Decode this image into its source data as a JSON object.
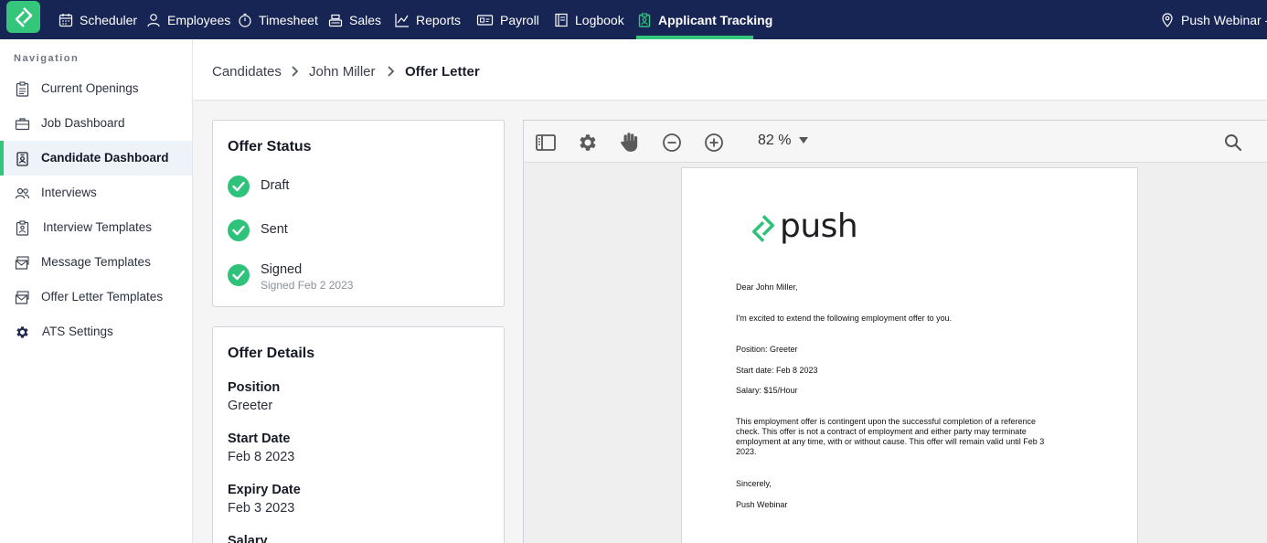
{
  "topnav": {
    "items": [
      {
        "label": "Scheduler",
        "icon": "calendar-icon"
      },
      {
        "label": "Employees",
        "icon": "person-icon"
      },
      {
        "label": "Timesheet",
        "icon": "stopwatch-icon"
      },
      {
        "label": "Sales",
        "icon": "register-icon"
      },
      {
        "label": "Reports",
        "icon": "chart-line-icon"
      },
      {
        "label": "Payroll",
        "icon": "money-icon"
      },
      {
        "label": "Logbook",
        "icon": "book-icon"
      },
      {
        "label": "Applicant Tracking",
        "icon": "clipboard-person-icon",
        "active": true
      }
    ],
    "location": "Push Webinar - A",
    "accent": "#34c77b",
    "background": "#172554"
  },
  "sidebar": {
    "heading": "Navigation",
    "items": [
      {
        "label": "Current Openings",
        "icon": "clipboard-list-icon"
      },
      {
        "label": "Job Dashboard",
        "icon": "briefcase-icon"
      },
      {
        "label": "Candidate Dashboard",
        "icon": "id-badge-icon",
        "active": true
      },
      {
        "label": "Interviews",
        "icon": "people-icon"
      },
      {
        "label": "Interview Templates",
        "icon": "clipboard-person-icon"
      },
      {
        "label": "Message Templates",
        "icon": "envelope-stack-icon"
      },
      {
        "label": "Offer Letter Templates",
        "icon": "envelope-stack-icon"
      },
      {
        "label": "ATS Settings",
        "icon": "gear-icon"
      }
    ]
  },
  "breadcrumb": [
    "Candidates",
    "John Miller",
    "Offer Letter"
  ],
  "offer_status": {
    "title": "Offer Status",
    "steps": [
      {
        "label": "Draft",
        "done": true
      },
      {
        "label": "Sent",
        "done": true
      },
      {
        "label": "Signed",
        "sub": "Signed Feb 2 2023",
        "done": true
      }
    ]
  },
  "offer_details": {
    "title": "Offer Details",
    "fields": [
      {
        "label": "Position",
        "value": "Greeter"
      },
      {
        "label": "Start Date",
        "value": "Feb 8 2023"
      },
      {
        "label": "Expiry Date",
        "value": "Feb 3 2023"
      },
      {
        "label": "Salary",
        "value": ""
      }
    ]
  },
  "viewer": {
    "zoom": "82 %",
    "toolbar_icons": [
      "sidebar-toggle-icon",
      "gear-icon",
      "hand-icon",
      "zoom-out-icon",
      "zoom-in-icon",
      "search-icon"
    ]
  },
  "letter": {
    "brand": "push",
    "greeting": "Dear John Miller,",
    "intro": "I'm excited to extend the following employment offer to you.",
    "position": "Position: Greeter",
    "start": "Start date: Feb 8 2023",
    "salary": "Salary: $15/Hour",
    "body_line1": "This employment offer is contingent upon the successful completion of a reference",
    "body_line2": "check. This offer is not a contract of employment and either party may terminate",
    "body_line3": "employment at any time, with or without cause. This offer will remain valid until Feb 3",
    "body_line4": "2023.",
    "closing": "Sincerely,",
    "signature": "Push Webinar"
  }
}
